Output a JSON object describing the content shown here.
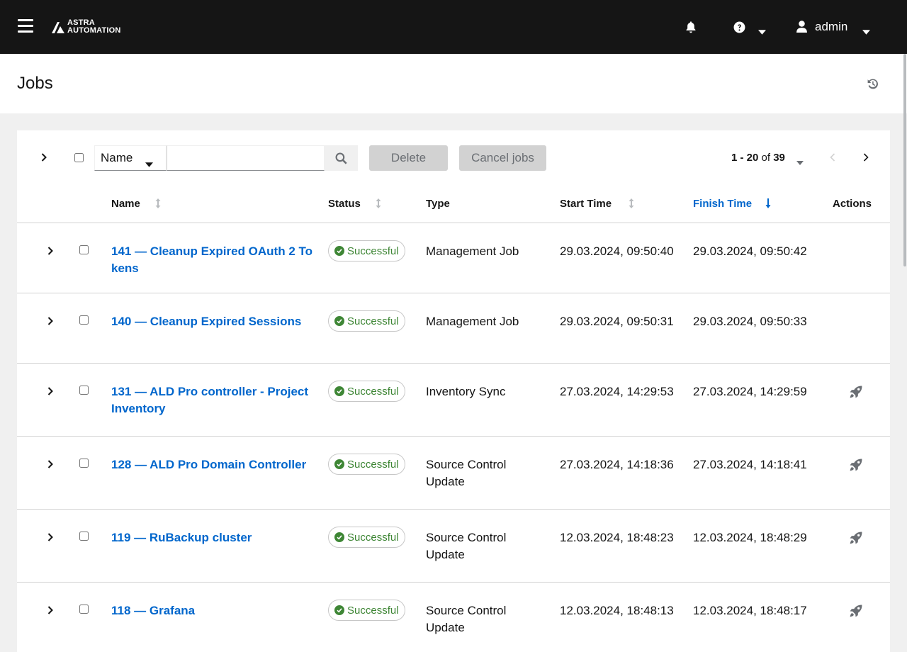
{
  "header": {
    "logo_line1": "ASTRA",
    "logo_line2": "AUTOMATION",
    "user_name": "admin"
  },
  "page": {
    "title": "Jobs"
  },
  "toolbar": {
    "filter_field": "Name",
    "search_value": "",
    "delete_label": "Delete",
    "cancel_label": "Cancel jobs",
    "pager_range": "1 - 20",
    "pager_of": "of",
    "pager_total": "39"
  },
  "table": {
    "columns": {
      "name": "Name",
      "status": "Status",
      "type": "Type",
      "start": "Start Time",
      "finish": "Finish Time",
      "actions": "Actions"
    },
    "sorted_column": "Finish Time",
    "sort_direction": "descending",
    "rows": [
      {
        "name": "141 — Cleanup Expired OAuth 2 Tokens",
        "status": "Successful",
        "type": "Management Job",
        "start": "29.03.2024, 09:50:40",
        "finish": "29.03.2024, 09:50:42",
        "action_icon": ""
      },
      {
        "name": "140 — Cleanup Expired Sessions",
        "status": "Successful",
        "type": "Management Job",
        "start": "29.03.2024, 09:50:31",
        "finish": "29.03.2024, 09:50:33",
        "action_icon": ""
      },
      {
        "name": "131 — ALD Pro controller - Project Inventory",
        "status": "Successful",
        "type": "Inventory Sync",
        "start": "27.03.2024, 14:29:53",
        "finish": "27.03.2024, 14:29:59",
        "action_icon": "rocket-icon"
      },
      {
        "name": "128 — ALD Pro Domain Controller",
        "status": "Successful",
        "type": "Source Control Update",
        "start": "27.03.2024, 14:18:36",
        "finish": "27.03.2024, 14:18:41",
        "action_icon": "rocket-icon"
      },
      {
        "name": "119 — RuBackup cluster",
        "status": "Successful",
        "type": "Source Control Update",
        "start": "12.03.2024, 18:48:23",
        "finish": "12.03.2024, 18:48:29",
        "action_icon": "rocket-icon"
      },
      {
        "name": "118 — Grafana",
        "status": "Successful",
        "type": "Source Control Update",
        "start": "12.03.2024, 18:48:13",
        "finish": "12.03.2024, 18:48:17",
        "action_icon": "rocket-icon"
      }
    ]
  },
  "colors": {
    "topbar": "#151515",
    "link": "#0066cc",
    "success": "#3e8635",
    "disabled_button": "#d2d2d2"
  }
}
